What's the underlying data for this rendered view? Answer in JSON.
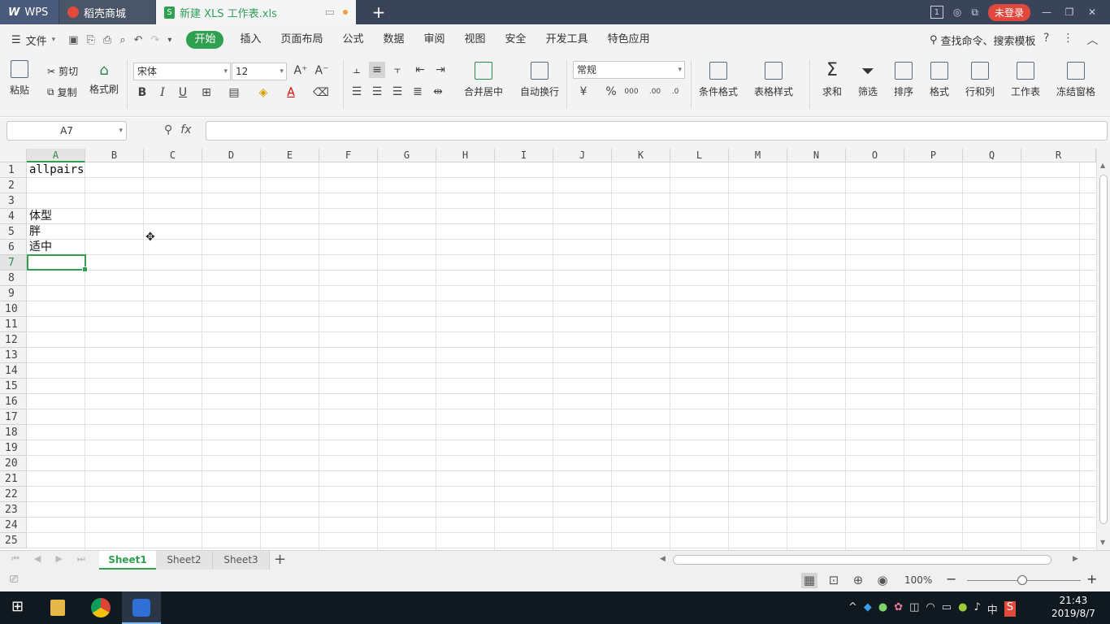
{
  "titlebar": {
    "tabs": [
      {
        "label": "WPS"
      },
      {
        "label": "稻壳商城"
      },
      {
        "label": "新建 XLS 工作表.xls"
      }
    ],
    "counter": "1",
    "login_label": "未登录"
  },
  "menubar": {
    "file_label": "文件",
    "items": [
      "开始",
      "插入",
      "页面布局",
      "公式",
      "数据",
      "审阅",
      "视图",
      "安全",
      "开发工具",
      "特色应用"
    ],
    "search_label": "查找命令、搜索模板"
  },
  "ribbon": {
    "paste": "粘贴",
    "cut": "剪切",
    "copy": "复制",
    "format_painter": "格式刷",
    "font_name": "宋体",
    "font_size": "12",
    "merge_center": "合并居中",
    "wrap_text": "自动换行",
    "number_format": "常规",
    "cond_format": "条件格式",
    "table_style": "表格样式",
    "sum": "求和",
    "filter": "筛选",
    "sort": "排序",
    "format": "格式",
    "row_col": "行和列",
    "worksheet": "工作表",
    "freeze": "冻结窗格"
  },
  "formula_bar": {
    "name_box": "A7",
    "fx_label": "fx",
    "formula": ""
  },
  "sheet": {
    "columns": [
      "A",
      "B",
      "C",
      "D",
      "E",
      "F",
      "G",
      "H",
      "I",
      "J",
      "K",
      "L",
      "M",
      "N",
      "O",
      "P",
      "Q",
      "R"
    ],
    "rows": [
      "1",
      "2",
      "3",
      "4",
      "5",
      "6",
      "7",
      "8",
      "9",
      "10",
      "11",
      "12",
      "13",
      "14",
      "15",
      "16",
      "17",
      "18",
      "19",
      "20",
      "21",
      "22",
      "23",
      "24",
      "25"
    ],
    "selected_cell": "A7",
    "cells": {
      "A1": "allpairs",
      "A4": "体型",
      "A5": "胖",
      "A6": "适中"
    }
  },
  "sheet_tabs": [
    "Sheet1",
    "Sheet2",
    "Sheet3"
  ],
  "status": {
    "zoom": "100%"
  },
  "taskbar": {
    "time": "21:43",
    "date": "2019/8/7",
    "ime": "中"
  }
}
